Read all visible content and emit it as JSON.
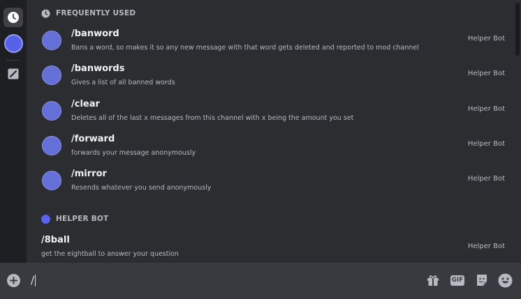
{
  "rail": {
    "items": [
      "clock-icon",
      "bot-avatar",
      "slash-command-icon"
    ]
  },
  "sections": {
    "frequently_used": "FREQUENTLY USED",
    "helper_bot": "HELPER BOT"
  },
  "commands": [
    {
      "name": "/banword",
      "description": "Bans a word, so makes it so any new message with that word gets deleted and reported to mod channel",
      "source": "Helper Bot"
    },
    {
      "name": "/banwords",
      "description": "Gives a list of all banned words",
      "source": "Helper Bot"
    },
    {
      "name": "/clear",
      "description": "Deletes all of the last x messages from this channel with x being the amount you set",
      "source": "Helper Bot"
    },
    {
      "name": "/forward",
      "description": "forwards your message anonymously",
      "source": "Helper Bot"
    },
    {
      "name": "/mirror",
      "description": "Resends whatever you send anonymously",
      "source": "Helper Bot"
    }
  ],
  "bot_commands": [
    {
      "name": "/8ball",
      "description": "get the eightball to answer your question",
      "source": "Helper Bot"
    }
  ],
  "chat_input": {
    "value": "/"
  },
  "toolbar": {
    "gif_label": "GIF",
    "icons": [
      "gift-icon",
      "gif-icon",
      "sticker-icon",
      "emoji-icon"
    ]
  },
  "colors": {
    "accent": "#5865f2",
    "background": "#2b2d31",
    "rail": "#1e1f22",
    "input_bar": "#383a40"
  }
}
